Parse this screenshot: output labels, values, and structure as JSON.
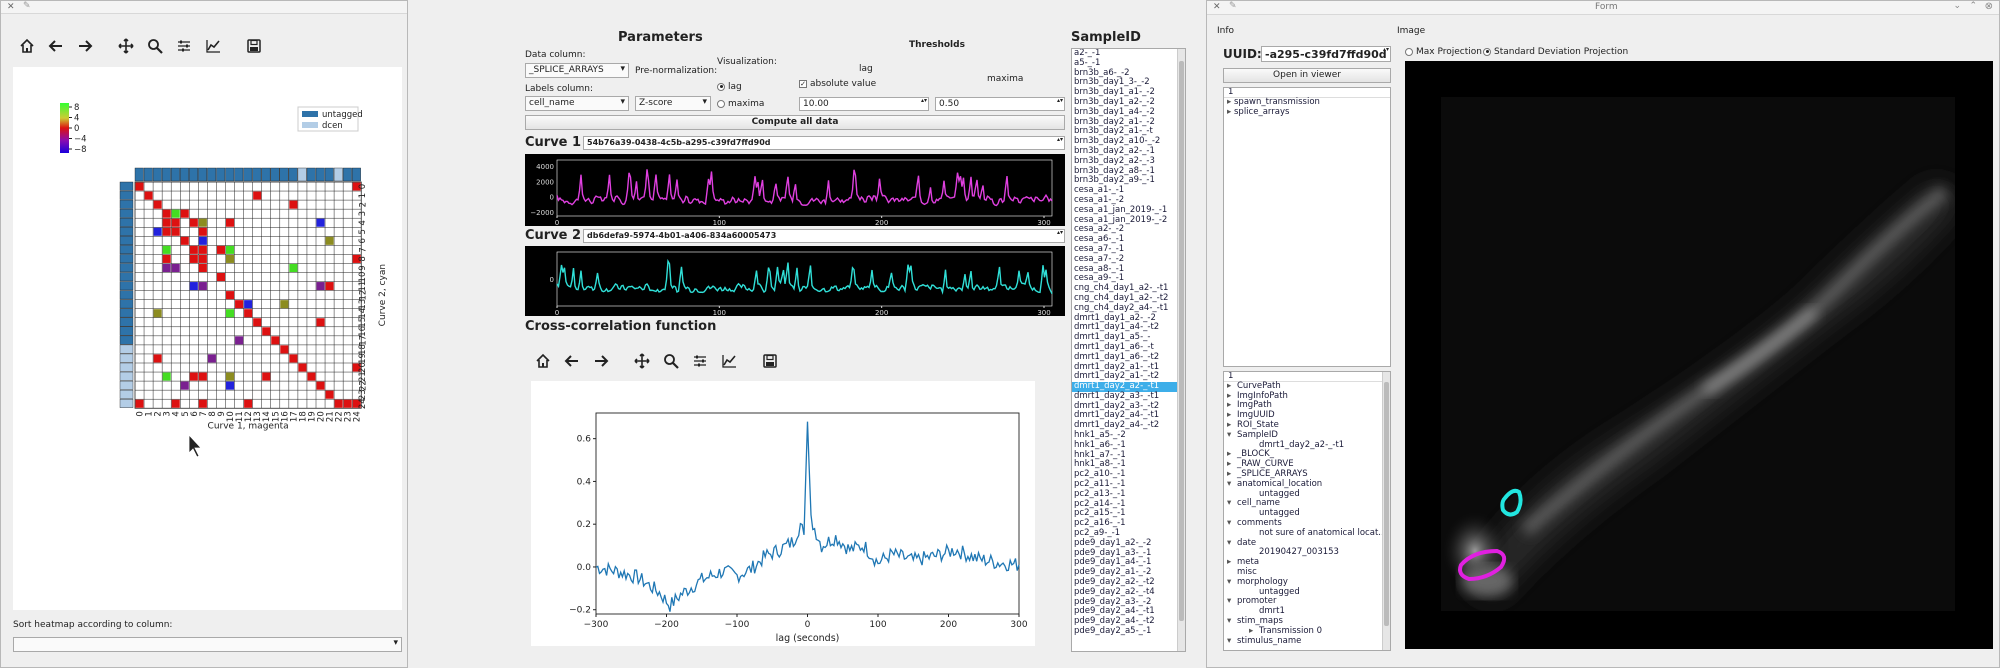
{
  "toolbar_left": [
    "home-icon",
    "back-icon",
    "forward-icon",
    "pan-icon",
    "zoom-icon",
    "configure-icon",
    "edit-axis-icon",
    "save-icon"
  ],
  "heatmap": {
    "colorbar_ticks": [
      "8",
      "4",
      "0",
      "−4",
      "−8"
    ],
    "legend": [
      "untagged",
      "dcen"
    ],
    "x_label": "Curve 1, magenta",
    "y_label": "Curve 2, cyan",
    "tick_labels": [
      "0",
      "1",
      "2",
      "3",
      "4",
      "5",
      "6",
      "7",
      "8",
      "9",
      "10",
      "11",
      "12",
      "13",
      "14",
      "15",
      "16",
      "17",
      "18",
      "19",
      "20",
      "21",
      "22",
      "23",
      "24"
    ],
    "sort_label": "Sort heatmap according to column:",
    "sort_value": ""
  },
  "params": {
    "title": "Parameters",
    "data_column_label": "Data column:",
    "data_column_value": "_SPLICE_ARRAYS",
    "prenorm_label": "Pre-normalization:",
    "prenorm_value": "Z-score",
    "labels_column_label": "Labels column:",
    "labels_column_value": "cell_name",
    "visualization_label": "Visualization:",
    "lag_label": "lag",
    "maxima_label": "maxima",
    "thresholds_label": "Thresholds",
    "lag_radio": "lag",
    "maxima_radio": "maxima",
    "absolute_value": "absolute value",
    "thr1": "10.00",
    "thr2": "0.50",
    "compute_all": "Compute all data"
  },
  "curve1": {
    "label": "Curve 1",
    "uuid": "54b76a39-0438-4c5b-a295-c39fd7ffd90d",
    "yticks": [
      "4000",
      "2000",
      "0",
      "−2000"
    ],
    "xticks": [
      "0",
      "100",
      "200",
      "300"
    ],
    "color": "#e040e0"
  },
  "curve2": {
    "label": "Curve 2",
    "uuid": "db6defa9-5974-4b01-a406-834a60005473",
    "yticks": [
      "0"
    ],
    "xticks": [
      "0",
      "100",
      "200",
      "300"
    ],
    "color": "#30e0d8"
  },
  "xcorr": {
    "title": "Cross-correlation function",
    "xlabel": "lag (seconds)",
    "xticks": [
      "−300",
      "−200",
      "−100",
      "0",
      "100",
      "200",
      "300"
    ],
    "yticks": [
      "0.6",
      "0.4",
      "0.2",
      "0.0",
      "−0.2"
    ]
  },
  "chart_data": {
    "type": "line",
    "title": "",
    "xlabel": "lag (seconds)",
    "ylabel": "",
    "xlim": [
      -300,
      300
    ],
    "ylim": [
      -0.22,
      0.72
    ],
    "x": [
      -300,
      -270,
      -240,
      -210,
      -195,
      -180,
      -150,
      -120,
      -100,
      -80,
      -60,
      -40,
      -20,
      -10,
      -5,
      0,
      5,
      10,
      20,
      40,
      60,
      80,
      100,
      120,
      150,
      180,
      210,
      240,
      270,
      300
    ],
    "series": [
      {
        "values": [
          0.0,
          -0.02,
          -0.05,
          -0.12,
          -0.18,
          -0.13,
          -0.06,
          -0.02,
          -0.04,
          -0.01,
          0.05,
          0.08,
          0.12,
          0.2,
          0.15,
          0.68,
          0.22,
          0.18,
          0.1,
          0.14,
          0.08,
          0.1,
          0.02,
          0.06,
          0.03,
          0.05,
          0.08,
          0.04,
          0.02,
          0.01
        ]
      }
    ]
  },
  "samples": {
    "header": "SampleID",
    "items": [
      "a2-_-1",
      "a5-_-1",
      "brn3b_a6-_-2",
      "brn3b_day1_3-_-2",
      "brn3b_day1_a1-_-2",
      "brn3b_day1_a2-_-2",
      "brn3b_day1_a4-_-2",
      "brn3b_day2_a1-_-2",
      "brn3b_day2_a1-_-t",
      "brn3b_day2_a10-_-2",
      "brn3b_day2_a2-_-1",
      "brn3b_day2_a2-_-3",
      "brn3b_day2_a8-_-1",
      "brn3b_day2_a9-_-1",
      "cesa_a1-_-1",
      "cesa_a1-_-2",
      "cesa_a1_jan_2019-_-1",
      "cesa_a1_jan_2019-_-2",
      "cesa_a2-_-2",
      "cesa_a6-_-1",
      "cesa_a7-_-1",
      "cesa_a7-_-2",
      "cesa_a8-_-1",
      "cesa_a9-_-1",
      "cng_ch4_day1_a2-_-t1",
      "cng_ch4_day1_a2-_-t2",
      "cng_ch4_day2_a4-_-t1",
      "dmrt1_day1_a2-_-2",
      "dmrt1_day1_a4-_-t2",
      "dmrt1_day1_a5-_-",
      "dmrt1_day1_a6-_-t",
      "dmrt1_day1_a6-_-t2",
      "dmrt1_day2_a1-_-t1",
      "dmrt1_day2_a1-_-t2",
      "dmrt1_day2_a2-_-t1",
      "dmrt1_day2_a3-_-t1",
      "dmrt1_day2_a3-_-t2",
      "dmrt1_day2_a4-_-t1",
      "dmrt1_day2_a4-_-t2",
      "hnk1_a5-_-2",
      "hnk1_a6-_-1",
      "hnk1_a7-_-1",
      "hnk1_a8-_-1",
      "pc2_a10-_-1",
      "pc2_a11-_-1",
      "pc2_a13-_-1",
      "pc2_a14-_-1",
      "pc2_a15-_-1",
      "pc2_a16-_-1",
      "pc2_a9-_-1",
      "pde9_day1_a2-_-2",
      "pde9_day1_a3-_-1",
      "pde9_day1_a4-_-1",
      "pde9_day2_a1-_-2",
      "pde9_day2_a2-_-t2",
      "pde9_day2_a2-_-t4",
      "pde9_day2_a3-_-2",
      "pde9_day2_a4-_-t1",
      "pde9_day2_a4-_-t2",
      "pde9_day2_a5-_-1"
    ],
    "selected_index": 34
  },
  "form": {
    "title": "Form",
    "info_label": "Info",
    "image_label": "Image",
    "uuid_label": "UUID:",
    "uuid_value": "-a295-c39fd7ffd90d",
    "open_viewer": "Open in viewer",
    "tree1_header": "1",
    "tree1": [
      "spawn_transmission",
      "splice_arrays"
    ],
    "tree2_header": "1",
    "tree2": [
      {
        "t": "CurvePath",
        "lvl": 0,
        "arrow": "▸"
      },
      {
        "t": "ImgInfoPath",
        "lvl": 0,
        "arrow": "▸"
      },
      {
        "t": "ImgPath",
        "lvl": 0,
        "arrow": "▸"
      },
      {
        "t": "ImgUUID",
        "lvl": 0,
        "arrow": "▸"
      },
      {
        "t": "ROI_State",
        "lvl": 0,
        "arrow": "▸"
      },
      {
        "t": "SampleID",
        "lvl": 0,
        "arrow": "▾"
      },
      {
        "t": "dmrt1_day2_a2-_-t1",
        "lvl": 1,
        "arrow": ""
      },
      {
        "t": "_BLOCK_",
        "lvl": 0,
        "arrow": "▸"
      },
      {
        "t": "_RAW_CURVE",
        "lvl": 0,
        "arrow": "▸"
      },
      {
        "t": "_SPLICE_ARRAYS",
        "lvl": 0,
        "arrow": "▸"
      },
      {
        "t": "anatomical_location",
        "lvl": 0,
        "arrow": "▾"
      },
      {
        "t": "untagged",
        "lvl": 1,
        "arrow": ""
      },
      {
        "t": "cell_name",
        "lvl": 0,
        "arrow": "▾"
      },
      {
        "t": "untagged",
        "lvl": 1,
        "arrow": ""
      },
      {
        "t": "comments",
        "lvl": 0,
        "arrow": "▾"
      },
      {
        "t": "not sure of anatomical locat...",
        "lvl": 1,
        "arrow": ""
      },
      {
        "t": "date",
        "lvl": 0,
        "arrow": "▾"
      },
      {
        "t": "20190427_003153",
        "lvl": 1,
        "arrow": ""
      },
      {
        "t": "meta",
        "lvl": 0,
        "arrow": "▸"
      },
      {
        "t": "misc",
        "lvl": 0,
        "arrow": ""
      },
      {
        "t": "morphology",
        "lvl": 0,
        "arrow": "▾"
      },
      {
        "t": "untagged",
        "lvl": 1,
        "arrow": ""
      },
      {
        "t": "promoter",
        "lvl": 0,
        "arrow": "▾"
      },
      {
        "t": "dmrt1",
        "lvl": 1,
        "arrow": ""
      },
      {
        "t": "stim_maps",
        "lvl": 0,
        "arrow": "▾"
      },
      {
        "t": "Transmission 0",
        "lvl": 1,
        "arrow": "▸"
      },
      {
        "t": "stimulus_name",
        "lvl": 0,
        "arrow": "▾"
      }
    ],
    "max_projection": "Max Projection",
    "std_projection": "Standard Deviation Projection"
  },
  "colors": {
    "selection": "#3daee9",
    "untagged": "#2e73a9",
    "dcen": "#b3cde6",
    "heat_red": "#dd1111",
    "heat_green": "#44dd22",
    "heat_blue": "#2222dd",
    "heat_purple": "#7a2090",
    "heat_olive": "#8c8c20"
  }
}
